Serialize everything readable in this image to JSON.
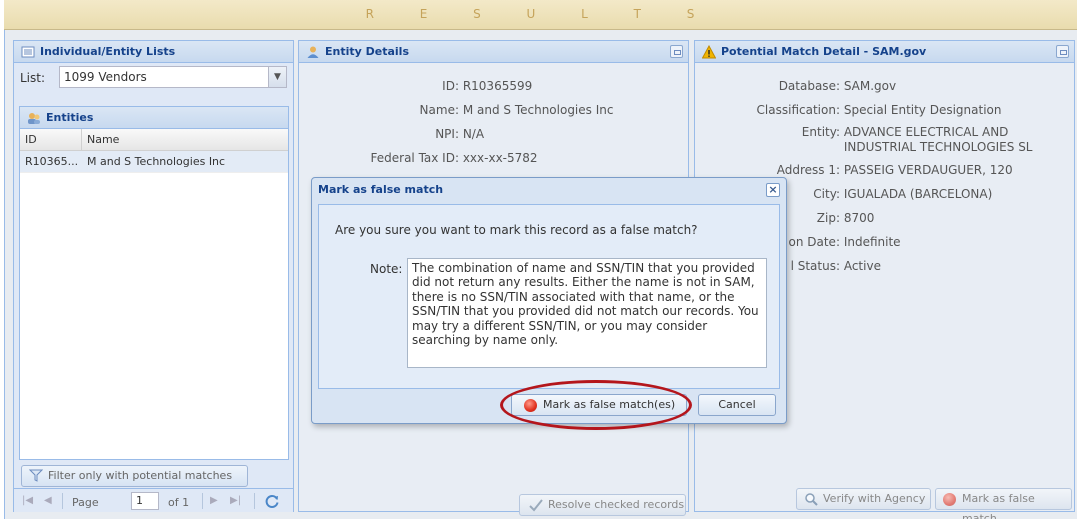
{
  "header": {
    "title": "R E S U L T S"
  },
  "left_panel": {
    "title": "Individual/Entity Lists",
    "list_label": "List:",
    "list_value": "1099 Vendors",
    "entities_title": "Entities",
    "columns": [
      "ID",
      "Name"
    ],
    "rows": [
      {
        "id": "R10365...",
        "name": "M and S Technologies Inc"
      }
    ],
    "filter_button": "Filter only with potential matches",
    "pager": {
      "page_label": "Page",
      "page_value": "1",
      "of_label": "of 1"
    }
  },
  "middle_panel": {
    "title": "Entity Details",
    "fields": [
      {
        "label": "ID:",
        "value": "R10365599"
      },
      {
        "label": "Name:",
        "value": "M and S Technologies Inc"
      },
      {
        "label": "NPI:",
        "value": "N/A"
      },
      {
        "label": "Federal Tax ID:",
        "value": "xxx-xx-5782"
      }
    ],
    "resolve_button": "Resolve checked records"
  },
  "right_panel": {
    "title": "Potential Match Detail - SAM.gov",
    "fields": [
      {
        "label": "Database:",
        "value": "SAM.gov"
      },
      {
        "label": "Classification:",
        "value": "Special Entity Designation"
      },
      {
        "label": "Entity:",
        "value": "ADVANCE ELECTRICAL AND"
      },
      {
        "label": "",
        "value": "INDUSTRIAL TECHNOLOGIES SL"
      },
      {
        "label": "Address 1:",
        "value": "PASSEIG VERDAUGUER, 120"
      },
      {
        "label": "City:",
        "value": "IGUALADA (BARCELONA)"
      },
      {
        "label": "Zip:",
        "value": "8700"
      },
      {
        "label": "on Date:",
        "value": "Indefinite"
      },
      {
        "label": "l Status:",
        "value": "Active"
      }
    ],
    "verify_button": "Verify with Agency",
    "mark_button": "Mark as false match"
  },
  "modal": {
    "title": "Mark as false match",
    "question": "Are you sure you want to mark this record as a false match?",
    "note_label": "Note:",
    "note_text": "The combination of name and SSN/TIN that you provided did not return any results. Either the name is not in SAM, there is no SSN/TIN associated with that name, or the SSN/TIN that you provided did not match our records. You may try a different SSN/TIN, or you may consider searching by name only.",
    "confirm_button": "Mark as false match(es)",
    "cancel_button": "Cancel",
    "close_glyph": "×"
  },
  "icons": {
    "list": "list-icon",
    "entities": "entities-icon",
    "entity_details": "person-icon",
    "warning": "warning-icon",
    "filter": "filter-icon",
    "refresh": "refresh-icon",
    "check": "check-icon",
    "verify": "magnifier-icon",
    "mark": "red-circle-icon"
  },
  "colors": {
    "accent": "#15428b",
    "highlight": "#b4161c",
    "warning": "#f0b400"
  }
}
